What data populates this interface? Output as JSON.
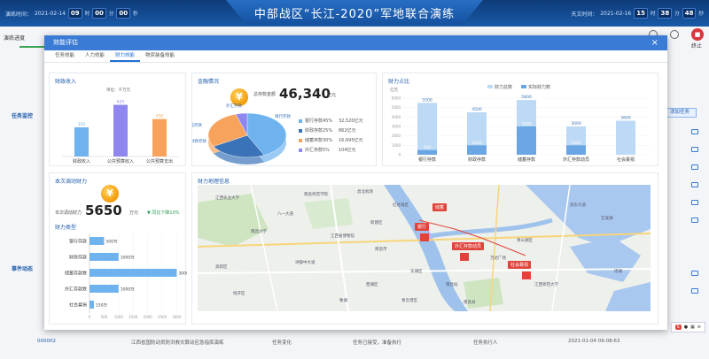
{
  "header": {
    "title": "中部战区“长江-2020”军地联合演练",
    "left_label": "演练时间：",
    "left_date": "2021-02-14",
    "left_h": "09",
    "left_m": "00",
    "left_s": "00",
    "unit_h": "时",
    "unit_m": "分",
    "unit_s": "秒",
    "right_label": "天文时间：",
    "right_date": "2021-02-16",
    "right_h": "15",
    "right_m": "38",
    "right_s": "48"
  },
  "background": {
    "progress_label": "演练进度",
    "stop_label": "终止",
    "panel1_label": "任务监控",
    "panel2_label": "事件动态",
    "add_button": "添加任务",
    "footer_row": {
      "id": "000002",
      "text": "江西省国防动员防洪救灾联动应急指挥演练",
      "type": "任务变化",
      "status": "任务已接受，准备执行",
      "person": "任务执行人",
      "time": "2021-01-04 09:08:63"
    }
  },
  "modal": {
    "title": "效能评估",
    "close": "×",
    "tabs": [
      "任务效能",
      "人力效能",
      "财力效能",
      "物资装备效能"
    ],
    "active_tab": 2
  },
  "revenue_card": {
    "title": "财政收入",
    "unit": "单位：千万元",
    "colors": [
      "#6fb3ee",
      "#8f86f0",
      "#f7a35c"
    ]
  },
  "finance_card": {
    "title": "金融情况",
    "total_label": "总存款金额",
    "total_value": "46,340",
    "total_unit": "亿元",
    "legend": [
      {
        "name": "银行存款45%",
        "value": "32,520亿元",
        "color": "#6fb3ee"
      },
      {
        "name": "财政存款25%",
        "value": "862亿元",
        "color": "#3a73b8"
      },
      {
        "name": "储蓄存款30%",
        "value": "16,695亿元",
        "color": "#f7a35c"
      },
      {
        "name": "外汇存款5%",
        "value": "104亿元",
        "color": "#8f86f0"
      }
    ],
    "slice_labels": [
      "外汇存款",
      "银行存款",
      "储蓄存款",
      "财政存款"
    ]
  },
  "ratio_card": {
    "title": "财力占比",
    "axis_unit": "亿元",
    "legend": [
      {
        "name": "财力总数",
        "color": "#bcd9f5"
      },
      {
        "name": "实际财力数",
        "color": "#6aa6e3"
      }
    ]
  },
  "mobilize_card": {
    "title": "本次调动财力",
    "label": "本次调动财力",
    "value": "5650",
    "unit": "万元",
    "trend": "▼ 同比下降10%",
    "type_title": "财力类型"
  },
  "geo_card": {
    "title": "财力地理信息",
    "pins": [
      "储蓄",
      "银行",
      "外汇存款动员",
      "社会募捐"
    ],
    "map_labels": [
      "江西农业大学",
      "八一大道",
      "南昌师范学院",
      "新建区",
      "南昌市",
      "青山湖区",
      "江西省博物馆",
      "南昌大学",
      "红谷滩区",
      "昌北机场",
      "艾溪湖",
      "瑶湖",
      "东湖区",
      "西湖区",
      "青云谱区",
      "南昌县",
      "洪都中大道",
      "江西师范大学",
      "象湖",
      "万达广场",
      "南昌站",
      "昌东大道",
      "高新区",
      "经开区"
    ]
  },
  "chart_data": [
    {
      "type": "bar",
      "title": "财政收入",
      "categories": [
        "财政收入",
        "公共预算收入",
        "公共预算支出"
      ],
      "values": [
        350,
        620,
        450
      ],
      "ylim": [
        0,
        700
      ]
    },
    {
      "type": "pie",
      "title": "金融情况",
      "categories": [
        "银行存款",
        "财政存款",
        "储蓄存款",
        "外汇存款"
      ],
      "values": [
        45,
        25,
        30,
        5
      ]
    },
    {
      "type": "bar",
      "title": "财力占比",
      "ylabel": "亿元",
      "categories": [
        "银行存款",
        "财政存款",
        "储蓄存款",
        "外汇存款动员",
        "社会募捐"
      ],
      "series": [
        {
          "name": "财力总数",
          "values": [
            5500,
            4500,
            5800,
            3000,
            3600
          ]
        },
        {
          "name": "实际财力数",
          "values": [
            500,
            1000,
            3000,
            1000,
            0
          ]
        }
      ],
      "ylim": [
        0,
        6000
      ]
    },
    {
      "type": "bar",
      "title": "财力类型",
      "categories": [
        "银行存款",
        "财政存款",
        "储蓄存款数",
        "外汇存款数",
        "社会募捐"
      ],
      "values": [
        500,
        1000,
        3000,
        1000,
        150
      ],
      "value_labels": [
        "500万",
        "1000万",
        "3000万",
        "1000万",
        "150万"
      ],
      "xticks": [
        0,
        500,
        1000,
        1500,
        2000,
        2500,
        3000
      ],
      "xlim": [
        0,
        3200
      ]
    }
  ]
}
